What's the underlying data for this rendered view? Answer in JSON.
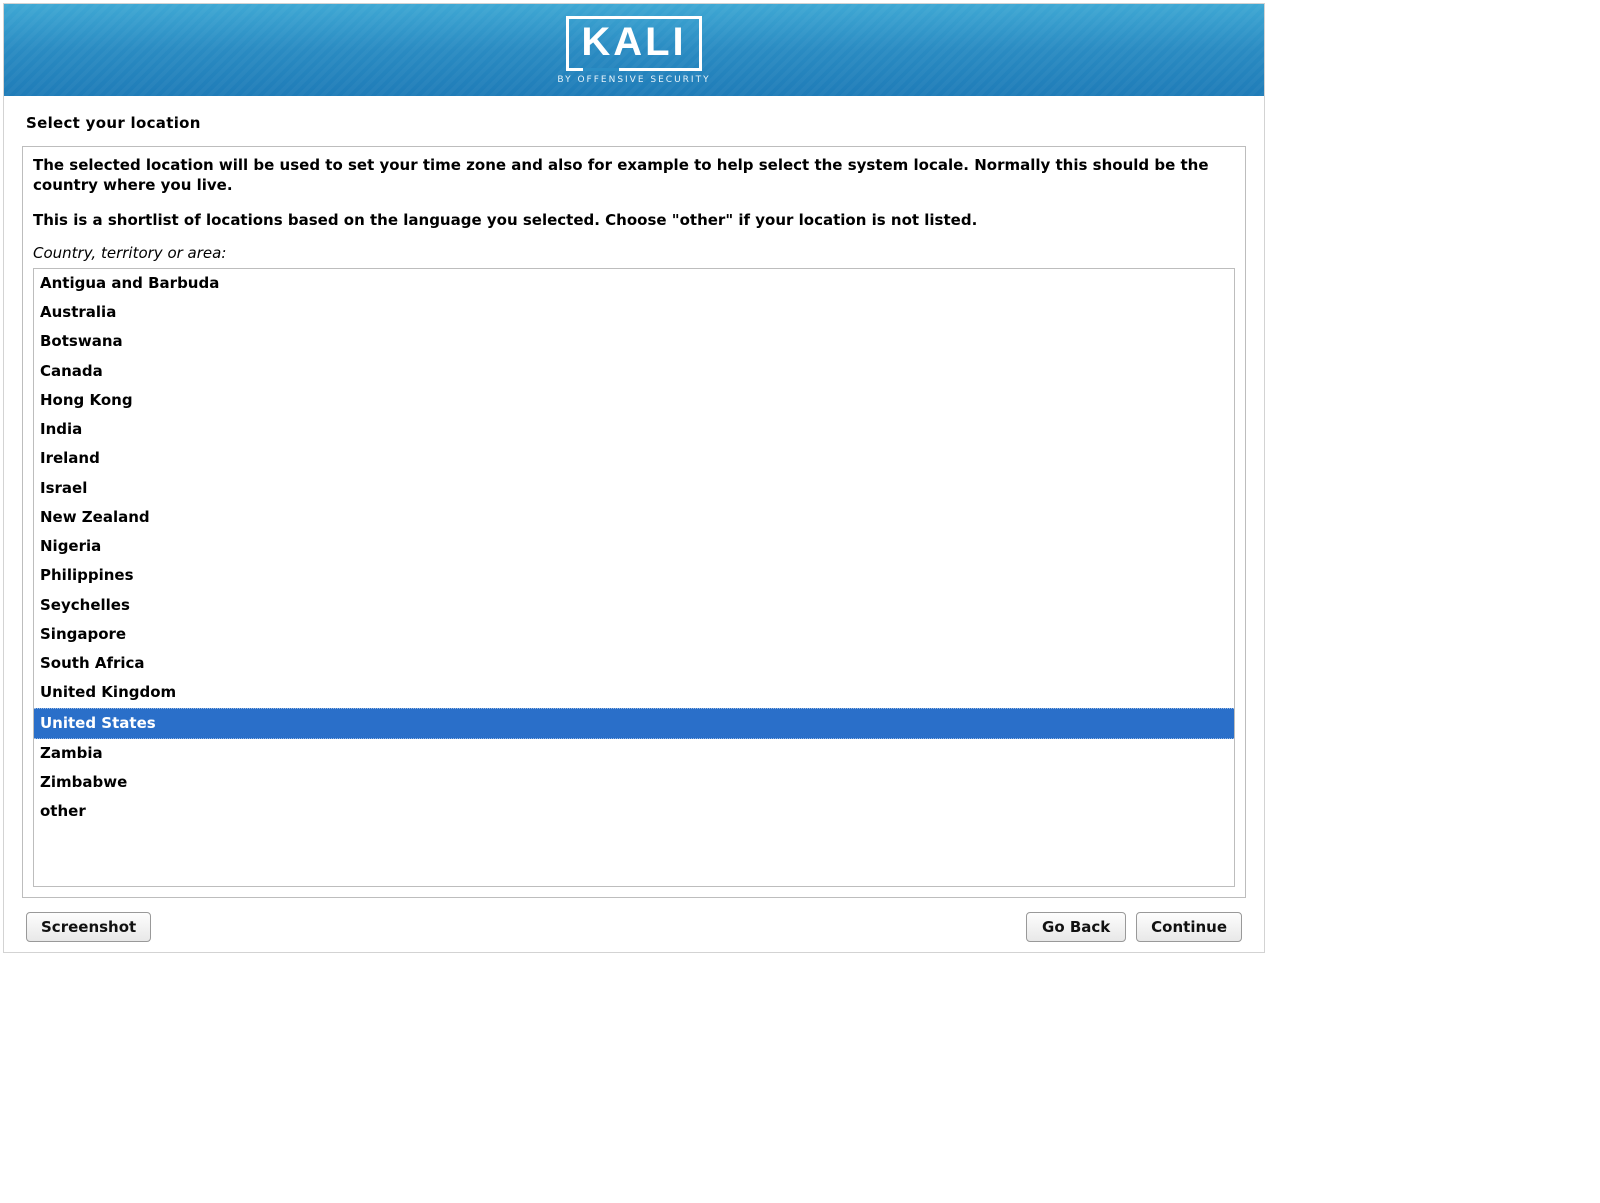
{
  "banner": {
    "logo_text": "KALI",
    "logo_subtitle": "BY OFFENSIVE SECURITY"
  },
  "page": {
    "title": "Select your location",
    "description_1": "The selected location will be used to set your time zone and also for example to help select the system locale. Normally this should be the country where you live.",
    "description_2": "This is a shortlist of locations based on the language you selected. Choose \"other\" if your location is not listed.",
    "field_label": "Country, territory or area:"
  },
  "locations": [
    {
      "label": "Antigua and Barbuda",
      "selected": false
    },
    {
      "label": "Australia",
      "selected": false
    },
    {
      "label": "Botswana",
      "selected": false
    },
    {
      "label": "Canada",
      "selected": false
    },
    {
      "label": "Hong Kong",
      "selected": false
    },
    {
      "label": "India",
      "selected": false
    },
    {
      "label": "Ireland",
      "selected": false
    },
    {
      "label": "Israel",
      "selected": false
    },
    {
      "label": "New Zealand",
      "selected": false
    },
    {
      "label": "Nigeria",
      "selected": false
    },
    {
      "label": "Philippines",
      "selected": false
    },
    {
      "label": "Seychelles",
      "selected": false
    },
    {
      "label": "Singapore",
      "selected": false
    },
    {
      "label": "South Africa",
      "selected": false
    },
    {
      "label": "United Kingdom",
      "selected": false
    },
    {
      "label": "United States",
      "selected": true
    },
    {
      "label": "Zambia",
      "selected": false
    },
    {
      "label": "Zimbabwe",
      "selected": false
    },
    {
      "label": "other",
      "selected": false
    }
  ],
  "buttons": {
    "screenshot": "Screenshot",
    "go_back": "Go Back",
    "continue": "Continue"
  }
}
